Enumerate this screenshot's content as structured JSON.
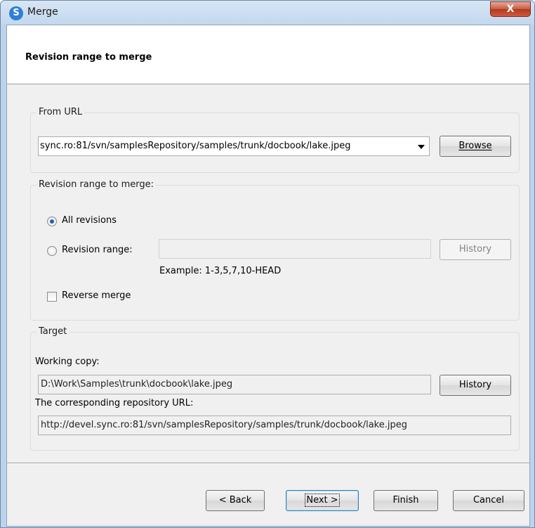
{
  "window": {
    "title": "Merge",
    "app_icon": "S",
    "close_glyph": "X"
  },
  "banner": {
    "title": "Revision range to merge"
  },
  "from_url": {
    "legend": "From URL",
    "value": "sync.ro:81/svn/samplesRepository/samples/trunk/docbook/lake.jpeg",
    "browse_label": "Browse"
  },
  "revision_range": {
    "legend": "Revision range to merge:",
    "all_revisions_label": "All revisions",
    "revision_range_label": "Revision range:",
    "revision_range_value": "",
    "history_label": "History",
    "example_text": "Example: 1-3,5,7,10-HEAD",
    "reverse_merge_label": "Reverse merge"
  },
  "target": {
    "legend": "Target",
    "working_copy_label": "Working copy:",
    "working_copy_value": "D:\\Work\\Samples\\trunk\\docbook\\lake.jpeg",
    "history_label": "History",
    "repo_url_label": "The corresponding repository URL:",
    "repo_url_value": "http://devel.sync.ro:81/svn/samplesRepository/samples/trunk/docbook/lake.jpeg"
  },
  "footer": {
    "back_label": "< Back",
    "next_label": "Next >",
    "finish_label": "Finish",
    "cancel_label": "Cancel"
  },
  "colors": {
    "accent": "#2f7fd6",
    "close": "#c75c44",
    "titlebar": "#c3d7ee"
  }
}
